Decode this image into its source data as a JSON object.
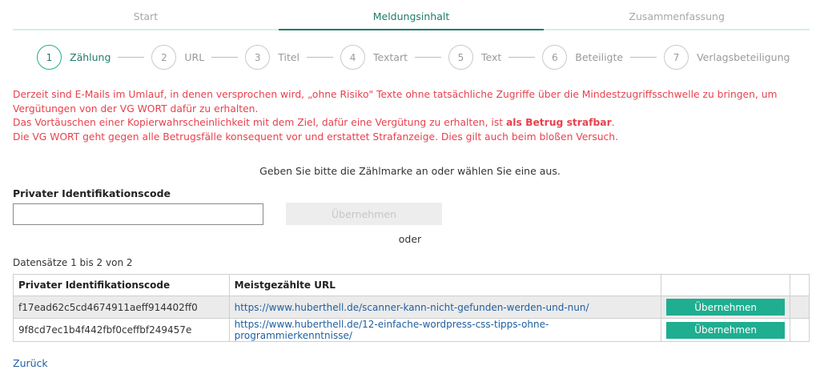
{
  "tabs": [
    {
      "label": "Start"
    },
    {
      "label": "Meldungsinhalt"
    },
    {
      "label": "Zusammenfassung"
    }
  ],
  "steps": [
    {
      "num": "1",
      "label": "Zählung"
    },
    {
      "num": "2",
      "label": "URL"
    },
    {
      "num": "3",
      "label": "Titel"
    },
    {
      "num": "4",
      "label": "Textart"
    },
    {
      "num": "5",
      "label": "Text"
    },
    {
      "num": "6",
      "label": "Beteiligte"
    },
    {
      "num": "7",
      "label": "Verlagsbeteiligung"
    }
  ],
  "warning": {
    "line1": "Derzeit sind E-Mails im Umlauf, in denen versprochen wird, „ohne Risiko\" Texte ohne tatsächliche Zugriffe über die Mindestzugriffsschwelle zu bringen, um Vergütungen von der VG WORT dafür zu erhalten.",
    "line2_pre": "Das Vortäuschen einer Kopierwahrscheinlichkeit mit dem Ziel, dafür eine Vergütung zu erhalten, ist ",
    "line2_bold": "als Betrug strafbar",
    "line2_post": ".",
    "line3": "Die VG WORT geht gegen alle Betrugsfälle konsequent vor und erstattet Strafanzeige. Dies gilt auch beim bloßen Versuch."
  },
  "instruction": "Geben Sie bitte die Zählmarke an oder wählen Sie eine aus.",
  "form": {
    "code_label": "Privater Identifikationscode",
    "code_value": "",
    "apply_label": "Übernehmen",
    "or_label": "oder"
  },
  "records_info": "Datensätze 1 bis 2 von 2",
  "table": {
    "headers": [
      "Privater Identifikationscode",
      "Meistgezählte URL",
      "",
      ""
    ],
    "rows": [
      {
        "code": "f17ead62c5cd4674911aeff914402ff0",
        "url": "https://www.huberthell.de/scanner-kann-nicht-gefunden-werden-und-nun/",
        "action": "Übernehmen"
      },
      {
        "code": "9f8cd7ec1b4f442fbf0ceffbf249457e",
        "url": "https://www.huberthell.de/12-einfache-wordpress-css-tipps-ohne-programmierkenntnisse/",
        "action": "Übernehmen"
      }
    ]
  },
  "back_label": "Zurück",
  "colors": {
    "accent": "#1fae90",
    "accent_dark": "#1f7a6a",
    "warning": "#e8414d",
    "link": "#1f5fa0"
  }
}
